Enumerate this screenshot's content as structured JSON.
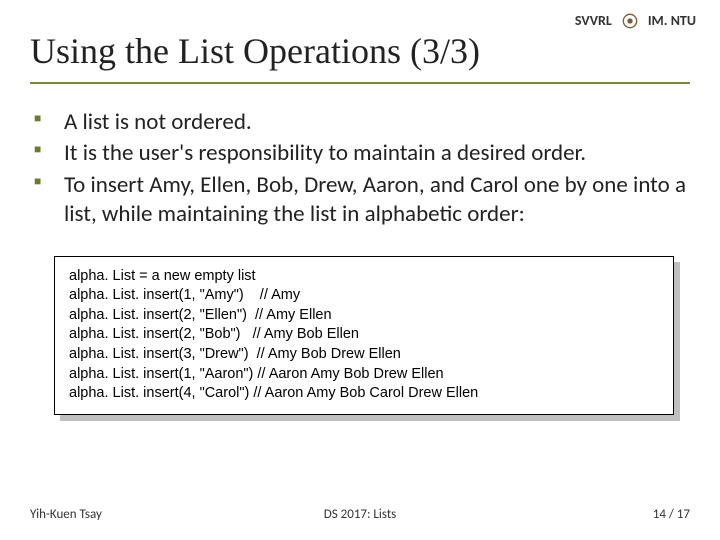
{
  "header": {
    "org_left": "SVVRL",
    "org_right": "IM. NTU"
  },
  "title": "Using the List Operations (3/3)",
  "bullets": [
    "A list is not ordered.",
    "It is the user's responsibility to maintain a desired order.",
    "To insert Amy, Ellen, Bob, Drew, Aaron, and Carol one by one into a list, while maintaining the list in alphabetic order:"
  ],
  "code": "alpha. List = a new empty list\nalpha. List. insert(1, \"Amy\")    // Amy\nalpha. List. insert(2, \"Ellen\")  // Amy Ellen\nalpha. List. insert(2, \"Bob\")   // Amy Bob Ellen\nalpha. List. insert(3, \"Drew\")  // Amy Bob Drew Ellen\nalpha. List. insert(1, \"Aaron\") // Aaron Amy Bob Drew Ellen\nalpha. List. insert(4, \"Carol\") // Aaron Amy Bob Carol Drew Ellen",
  "footer": {
    "author": "Yih-Kuen Tsay",
    "course": "DS 2017: Lists",
    "page": "14 / 17"
  }
}
